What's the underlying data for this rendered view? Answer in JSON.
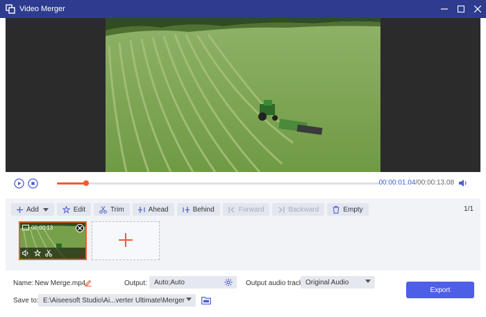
{
  "window": {
    "title": "Video Merger"
  },
  "player": {
    "current_time": "00:00:01.04",
    "separator": "/",
    "total_time": "00:00:13.08",
    "progress_fraction": 0.091
  },
  "toolbar": {
    "add": "Add",
    "edit": "Edit",
    "trim": "Trim",
    "ahead": "Ahead",
    "behind": "Behind",
    "forward": "Forward",
    "backward": "Backward",
    "empty": "Empty",
    "page_count": "1/1"
  },
  "clip": {
    "duration": "00:00:13"
  },
  "output": {
    "name_label": "Name:",
    "name_value": "New Merge.mp4",
    "output_label": "Output:",
    "output_value": "Auto;Auto",
    "audio_label": "Output audio track:",
    "audio_value": "Original Audio",
    "save_label": "Save to:",
    "save_path": "E:\\Aiseesoft Studio\\Ai...verter Ultimate\\Merger",
    "export": "Export"
  },
  "colors": {
    "title_bar": "#2e3c8f",
    "accent": "#f15b2a",
    "export": "#4d5fe6",
    "time_current": "#3a5fd9"
  }
}
